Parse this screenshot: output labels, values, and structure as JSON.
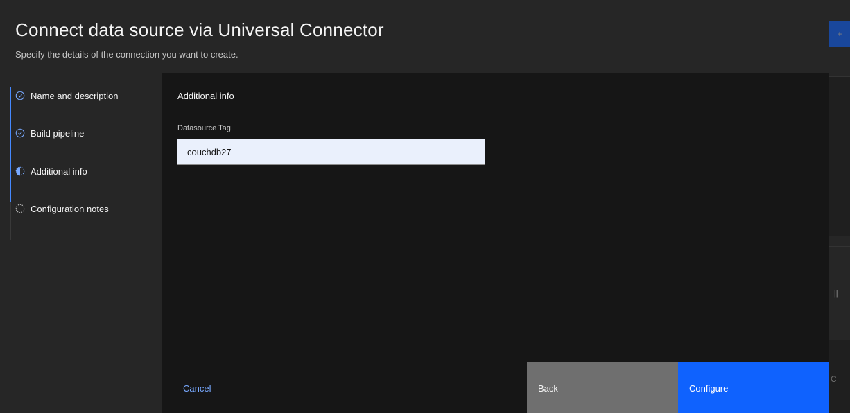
{
  "modal": {
    "title": "Connect data source via Universal Connector",
    "subtitle": "Specify the details of the connection you want to create."
  },
  "steps": [
    {
      "label": "Name and description",
      "status": "complete"
    },
    {
      "label": "Build pipeline",
      "status": "complete"
    },
    {
      "label": "Additional info",
      "status": "current"
    },
    {
      "label": "Configuration notes",
      "status": "incomplete"
    }
  ],
  "content": {
    "section_title": "Additional info",
    "datasource_tag": {
      "label": "Datasource Tag",
      "value": "couchdb27"
    }
  },
  "footer": {
    "cancel_label": "Cancel",
    "back_label": "Back",
    "configure_label": "Configure"
  },
  "colors": {
    "accent": "#0f62fe",
    "progress": "#4589ff",
    "link": "#78a9ff"
  }
}
